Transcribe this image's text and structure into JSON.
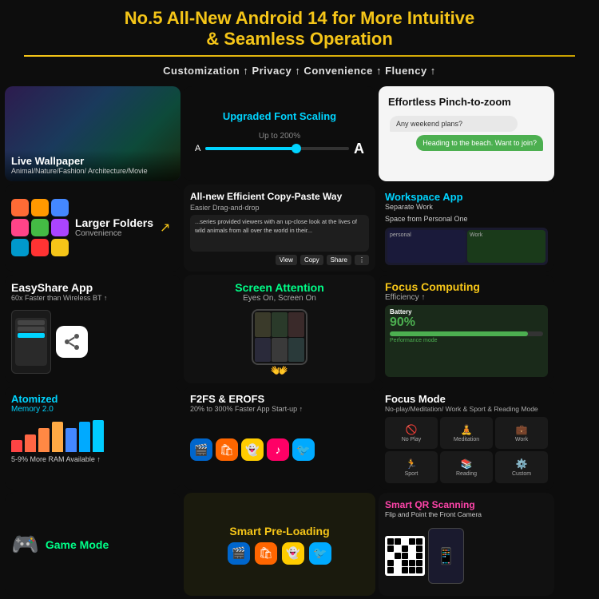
{
  "header": {
    "title_line1": "No.5 All-New Android 14 for More Intuitive",
    "title_line2": "& Seamless Operation",
    "subtitle": "Customization ↑  Privacy ↑  Convenience ↑  Fluency ↑"
  },
  "cells": {
    "live_wallpaper": {
      "title": "Live Wallpaper",
      "subtitle": "Animal/Nature/Fashion/\nArchitecture/Movie"
    },
    "font_scaling": {
      "title": "Upgraded Font Scaling",
      "percent": "Up to 200%"
    },
    "pinch_zoom": {
      "title": "Effortless Pinch-to-zoom",
      "bubble1": "Any weekend plans?",
      "bubble2": "Heading to the beach. Want to join?"
    },
    "folders": {
      "title": "Larger\nFolders",
      "sub": "Convenience"
    },
    "copy_paste": {
      "title": "All-new Efficient Copy-Paste Way",
      "sub": "Easier Drag-and-drop",
      "body_text": "...series provided viewers with an up-close look at the lives of wild animals from all over the world in their...",
      "actions": [
        "View",
        "Copy",
        "Share"
      ]
    },
    "workspace": {
      "title": "Workspace App",
      "sub1": "Separate Work",
      "sub2": "Space from Personal One"
    },
    "easyshare": {
      "title": "EasyShare App",
      "sub": "60x Faster than\nWireless BT ↑"
    },
    "screen_attention": {
      "title": "Screen Attention",
      "sub": "Eyes On, Screen On"
    },
    "focus_computing": {
      "title": "Focus\nComputing",
      "sub": "Efficiency ↑",
      "battery_title": "Battery",
      "battery_percent": "90%",
      "battery_mode": "Performance mode"
    },
    "focus_mode": {
      "title": "Focus Mode",
      "sub": "No-play/Meditation/\nWork & Sport & Reading\nMode",
      "modes": [
        "No Play",
        "Meditation",
        "Work",
        "Sport",
        "Reading",
        "Custom"
      ]
    },
    "atomized_memory": {
      "title": "Atomized",
      "version": "Memory 2.0",
      "sub": "5-9% More\nRAM Available ↑"
    },
    "f2fs": {
      "title": "F2FS & EROFS",
      "sub": "20% to 300%\nFaster App Start-up ↑"
    },
    "smart_preloading": {
      "title": "Smart\nPre-Loading"
    },
    "game_mode": {
      "title": "Game Mode"
    },
    "smart_qr": {
      "title": "Smart QR Scanning",
      "sub": "Flip and Point the\nFront Camera"
    }
  }
}
